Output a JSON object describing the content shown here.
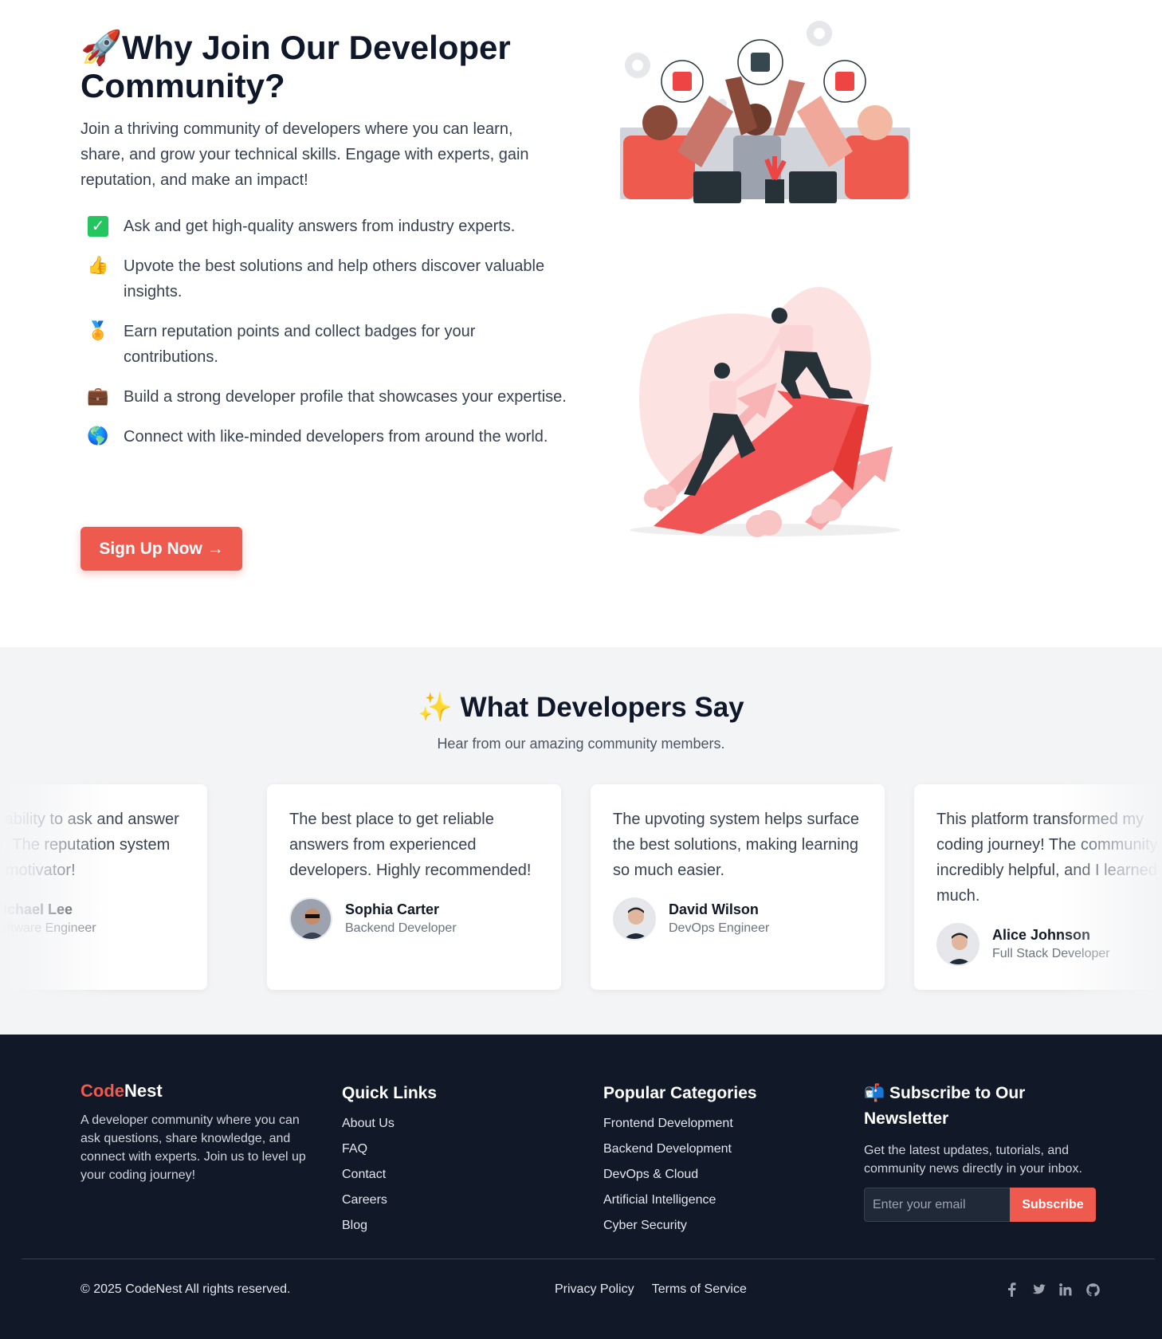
{
  "why": {
    "title_emoji": "🚀",
    "title": "Why Join Our Developer Community?",
    "intro": "Join a thriving community of developers where you can learn, share, and grow your technical skills. Engage with experts, gain reputation, and make an impact!",
    "benefits": [
      {
        "icon": "check-icon",
        "glyph": "✓",
        "text": "Ask and get high-quality answers from industry experts."
      },
      {
        "icon": "thumbs-up-icon",
        "glyph": "👍",
        "text": "Upvote the best solutions and help others discover valuable insights."
      },
      {
        "icon": "medal-icon",
        "glyph": "🏅",
        "text": "Earn reputation points and collect badges for your contributions."
      },
      {
        "icon": "briefcase-icon",
        "glyph": "💼",
        "text": "Build a strong developer profile that showcases your expertise."
      },
      {
        "icon": "globe-icon",
        "glyph": "🌎",
        "text": "Connect with like-minded developers from around the world."
      }
    ],
    "cta": "Sign Up Now →"
  },
  "testimonials": {
    "title_emoji": "✨",
    "title": "What Developers Say",
    "subtitle": "Hear from our amazing community members.",
    "cards": [
      {
        "quote": "I love the ability to ask and answer questions. The reputation system is a great motivator!",
        "name": "Michael Lee",
        "role": "Software Engineer"
      },
      {
        "quote": "The best place to get reliable answers from experienced developers. Highly recommended!",
        "name": "Sophia Carter",
        "role": "Backend Developer"
      },
      {
        "quote": "The upvoting system helps surface the best solutions, making learning so much easier.",
        "name": "David Wilson",
        "role": "DevOps Engineer"
      },
      {
        "quote": "This platform transformed my coding journey! The community is incredibly helpful, and I learned so much.",
        "name": "Alice Johnson",
        "role": "Full Stack Developer"
      }
    ]
  },
  "footer": {
    "brand_code": "Code",
    "brand_nest": "Nest",
    "description": "A developer community where you can ask questions, share knowledge, and connect with experts. Join us to level up your coding journey!",
    "quick_links_title": "Quick Links",
    "quick_links": [
      "About Us",
      "FAQ",
      "Contact",
      "Careers",
      "Blog"
    ],
    "categories_title": "Popular Categories",
    "categories": [
      "Frontend Development",
      "Backend Development",
      "DevOps & Cloud",
      "Artificial Intelligence",
      "Cyber Security"
    ],
    "newsletter_emoji": "📬",
    "newsletter_title": "Subscribe to Our Newsletter",
    "newsletter_text": "Get the latest updates, tutorials, and community news directly in your inbox.",
    "email_placeholder": "Enter your email",
    "subscribe_label": "Subscribe",
    "copyright": "© 2025 CodeNest All rights reserved.",
    "privacy": "Privacy Policy",
    "terms": "Terms of Service",
    "socials": [
      "facebook-icon",
      "twitter-icon",
      "linkedin-icon",
      "github-icon"
    ]
  },
  "colors": {
    "accent": "#ef5a4e",
    "heading": "#0f172a",
    "footer_bg": "#111827",
    "testimonial_bg": "#f3f4f6"
  }
}
